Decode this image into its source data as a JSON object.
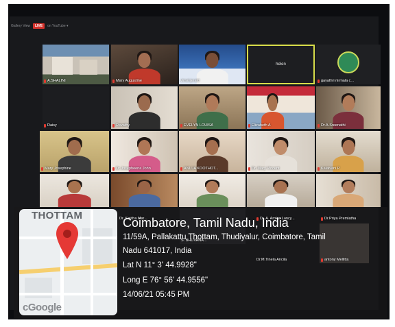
{
  "meeting": {
    "topbar": {
      "view_label": "Gallery View",
      "live_badge": "LIVE",
      "stream_label": "on YouTube ▾"
    },
    "participants": [
      {
        "name": "A.SHALINI",
        "tile_style": "building"
      },
      {
        "name": "Mary Augustine",
        "tile_style": "person"
      },
      {
        "name": "vimal jerald",
        "tile_style": "poster"
      },
      {
        "name": "helen",
        "tile_style": "name-only",
        "active_speaker": true
      },
      {
        "name": "gayathri nirmala c...",
        "tile_style": "logo"
      },
      {
        "name": "Daisy",
        "tile_style": "dark"
      },
      {
        "name": "Revathy",
        "tile_style": "person"
      },
      {
        "name": "EVELYN LOUISA",
        "tile_style": "person"
      },
      {
        "name": "Elizabeth A",
        "tile_style": "banner"
      },
      {
        "name": "Dr.A.Sreenathi",
        "tile_style": "person"
      },
      {
        "name": "Mary Josephine",
        "tile_style": "person"
      },
      {
        "name": "Dr Josepheena John",
        "tile_style": "person"
      },
      {
        "name": "ANUJA KOOTHOT...",
        "tile_style": "person"
      },
      {
        "name": "Dr. Mary Vincent",
        "tile_style": "person"
      },
      {
        "name": "Kalaivani P",
        "tile_style": "person"
      },
      {
        "name": "",
        "tile_style": "person"
      },
      {
        "name": "Dr. Sajitha Mar...",
        "tile_style": "person"
      },
      {
        "name": "S. BHUVANA...",
        "tile_style": "person"
      },
      {
        "name": "Dr. A. Arokia Lancy...",
        "tile_style": "person"
      },
      {
        "name": "Dr.Priya Premlatha",
        "tile_style": "person"
      },
      {
        "name": "Dr.M.Tinela Ancila",
        "tile_style": "dark"
      },
      {
        "name": "antony Mellitta",
        "tile_style": "person"
      }
    ]
  },
  "geotag": {
    "map_place_label": "THOTTAM",
    "map_provider_logo": "Google",
    "map_provider_logo_alt": "cGoogle",
    "city_line": "Coimbatore, Tamil Nadu, India",
    "address_line_1": "11/59A, Pallakattu Thottam, Thudiyalur, Coimbatore, Tamil",
    "address_line_2": "Nadu 641017, India",
    "latitude": "Lat N 11° 3' 44.9928\"",
    "longitude": "Long E 76° 56' 44.9556\"",
    "datetime": "14/06/21 05:45 PM",
    "pin_icon": "location-pin-icon",
    "pin_color": "#e53935"
  },
  "colors": {
    "active_speaker_border": "#d8dd4a",
    "muted_mic": "#e03a30",
    "live_badge": "#d4322c"
  }
}
